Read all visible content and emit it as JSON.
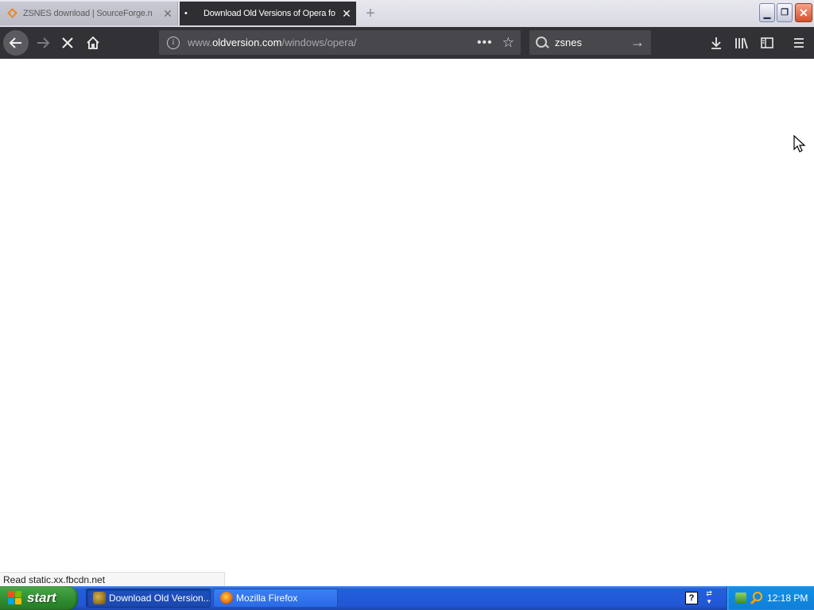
{
  "browser": {
    "tabs": [
      {
        "title": "ZSNES download | SourceForge.n",
        "active": false,
        "icon": "sourceforge-icon"
      },
      {
        "title": "Download Old Versions of Opera fo",
        "active": true,
        "icon": "loading-dot"
      }
    ],
    "new_tab": "+",
    "url_prefix": "www.",
    "url_domain": "oldversion.com",
    "url_path": "/windows/opera/",
    "search_value": "zsnes",
    "status_text": "Read static.xx.fbcdn.net"
  },
  "taskbar": {
    "start_label": "start",
    "items": [
      {
        "label": "Download Old Version...",
        "active": true
      },
      {
        "label": "Mozilla Firefox",
        "active": false
      }
    ],
    "clock": "12:18 PM"
  },
  "colors": {
    "toolbar": "#323236",
    "taskbar": "#245edc",
    "start": "#2f8b2f"
  }
}
